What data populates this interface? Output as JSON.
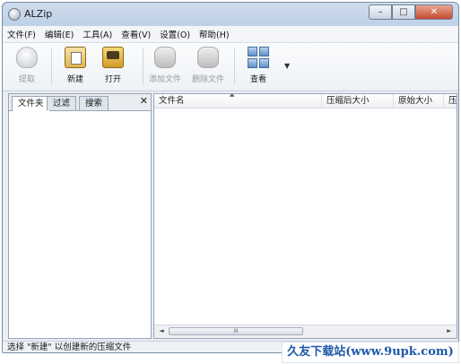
{
  "window": {
    "title": "ALZip"
  },
  "window_controls": {
    "minimize": "–",
    "maximize": "□",
    "close": "✕"
  },
  "menu": [
    "文件(F)",
    "编辑(E)",
    "工具(A)",
    "查看(V)",
    "设置(O)",
    "帮助(H)"
  ],
  "toolbar": {
    "extract": "提取",
    "new": "新建",
    "open": "打开",
    "add_files": "添加文件",
    "delete_files": "删除文件",
    "view": "查看",
    "view_dropdown": "▼"
  },
  "left_panel": {
    "tabs": [
      "文件夹",
      "过滤",
      "搜索"
    ],
    "close": "✕"
  },
  "file_list": {
    "columns": [
      "文件名",
      "压缩后大小",
      "原始大小",
      "压缩"
    ]
  },
  "scrollbar": {
    "left": "◄",
    "right": "►",
    "thumb": "III"
  },
  "statusbar": {
    "text": "选择 \"新建\" 以创建新的压缩文件"
  },
  "watermark": {
    "text": "久友下载站(www.9upk.com)"
  }
}
